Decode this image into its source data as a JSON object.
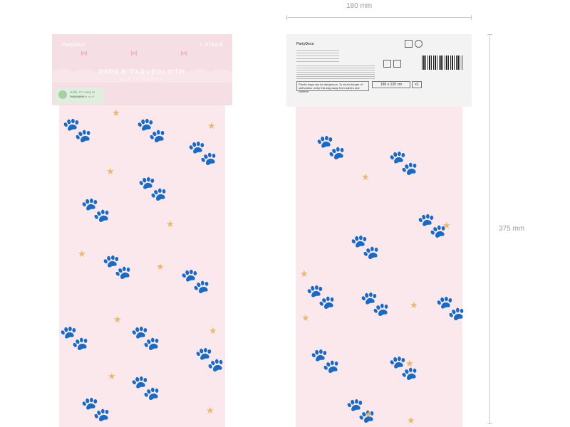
{
  "dimensions": {
    "width_label": "180 mm",
    "height_label": "375 mm"
  },
  "front": {
    "brand": "PartyDeco",
    "pieces": "1 PIECE",
    "title": "PAPER TABLECLOTH",
    "subtitle": "KITTY PARTY",
    "eco_line1": "Hello, I'm easy to segregate.",
    "eco_line2": "Remember to do it!"
  },
  "back": {
    "brand": "PartyDeco",
    "size": "180 x 120 cm",
    "quantity": "x1",
    "warning": "Plastic bags can be dangerous. To avoid danger of suffocation, keep this bag away from babies and children."
  },
  "colors": {
    "pink": "#fbe8ed",
    "paw": "#f3b7c9",
    "star": "#e8ba6a"
  },
  "icons": [
    "paw-print-icon",
    "star-icon",
    "bow-icon",
    "recycle-icon",
    "barcode"
  ]
}
